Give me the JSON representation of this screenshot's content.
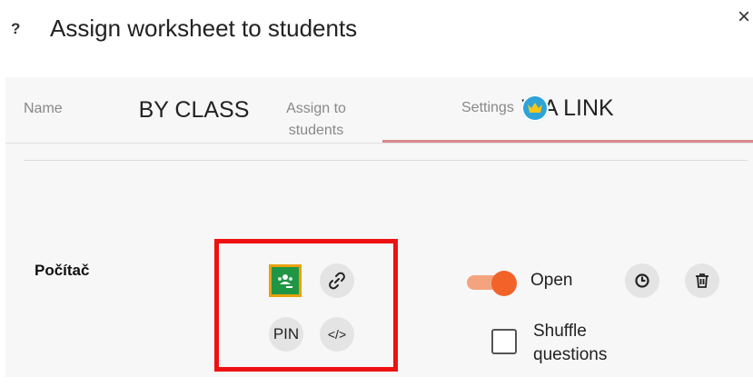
{
  "header": {
    "help_glyph": "?",
    "title": "Assign worksheet to students",
    "close_glyph": "×"
  },
  "tabs": [
    {
      "label": "BY CLASS",
      "active": false
    },
    {
      "label": "VIA LINK",
      "active": true
    }
  ],
  "table": {
    "columns": {
      "name": "Name",
      "assign_line1": "Assign to",
      "assign_line2": "students",
      "settings": "Settings"
    },
    "rows": [
      {
        "name": "Počítač",
        "assign_icons": [
          "google-classroom-icon",
          "link-icon",
          "pin-button",
          "embed-code-icon"
        ],
        "pin_label": "PIN",
        "embed_label": "</>",
        "status_label": "Open",
        "status_open": true,
        "shuffle_line1": "Shuffle",
        "shuffle_line2": "questions",
        "shuffle_checked": false
      }
    ]
  },
  "colors": {
    "accent": "#f2632a",
    "tab_underline": "#d9878f",
    "highlight": "#ee1111",
    "classroom_green": "#1f9546",
    "classroom_frame": "#e8a20c",
    "premium_blue": "#2ea3d8"
  }
}
